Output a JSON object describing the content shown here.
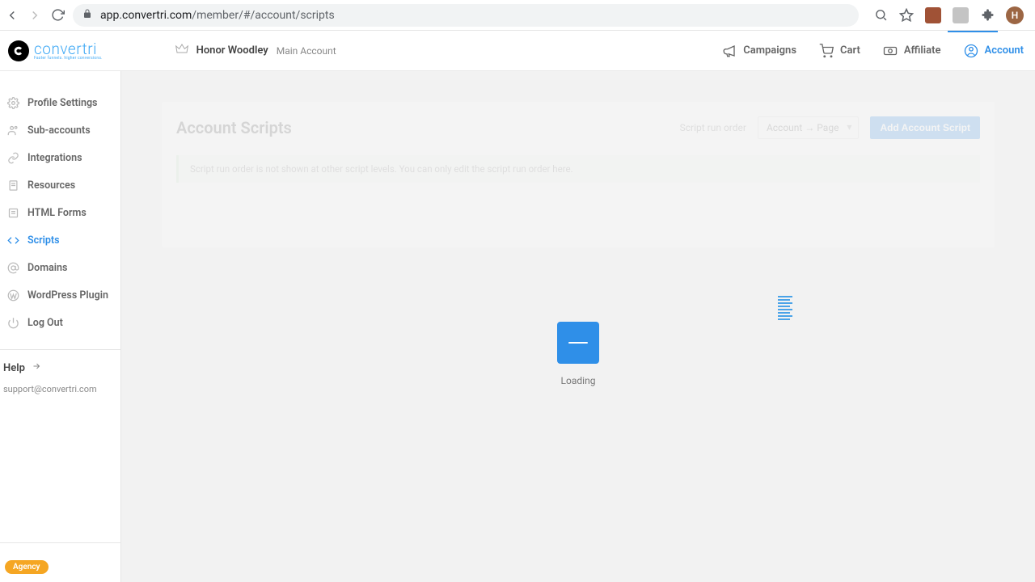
{
  "browser": {
    "url_host": "app.convertri.com",
    "url_path": "/member/#/account/scripts",
    "profile_initial": "H"
  },
  "header": {
    "brand": "convertri",
    "tagline": "Faster funnels. higher conversions.",
    "user_name": "Honor Woodley",
    "account_label": "Main Account",
    "nav": [
      {
        "label": "Campaigns"
      },
      {
        "label": "Cart"
      },
      {
        "label": "Affiliate"
      },
      {
        "label": "Account"
      }
    ]
  },
  "sidebar": {
    "items": [
      {
        "label": "Profile Settings"
      },
      {
        "label": "Sub-accounts"
      },
      {
        "label": "Integrations"
      },
      {
        "label": "Resources"
      },
      {
        "label": "HTML Forms"
      },
      {
        "label": "Scripts"
      },
      {
        "label": "Domains"
      },
      {
        "label": "WordPress Plugin"
      },
      {
        "label": "Log Out"
      }
    ],
    "help_label": "Help",
    "support_email": "support@convertri.com",
    "agency_badge": "Agency"
  },
  "main": {
    "title": "Account Scripts",
    "order_label": "Script run order",
    "order_selected": "Account → Page",
    "add_button": "Add Account Script",
    "info_text": "Script run order is not shown at other script levels. You can only edit the script run order here.",
    "loading_label": "Loading"
  }
}
